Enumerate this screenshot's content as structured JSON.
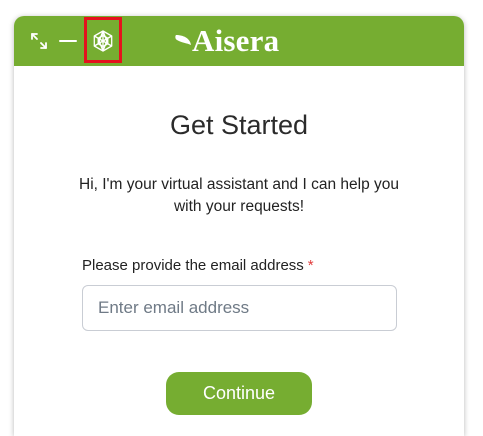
{
  "header": {
    "brand": "Aisera",
    "icons": {
      "expand": "expand-arrows-icon",
      "minimize": "minimize-icon",
      "ai": "ai-network-icon",
      "logo": "leaf-logo-icon"
    },
    "accent_color": "#76ad31",
    "highlight_color": "#e5121d"
  },
  "main": {
    "title": "Get Started",
    "intro": "Hi, I'm your virtual assistant and I can help you with your requests!",
    "email_label": "Please provide the email address",
    "required_marker": "*",
    "email_placeholder": "Enter email address",
    "email_value": "",
    "continue_label": "Continue"
  }
}
